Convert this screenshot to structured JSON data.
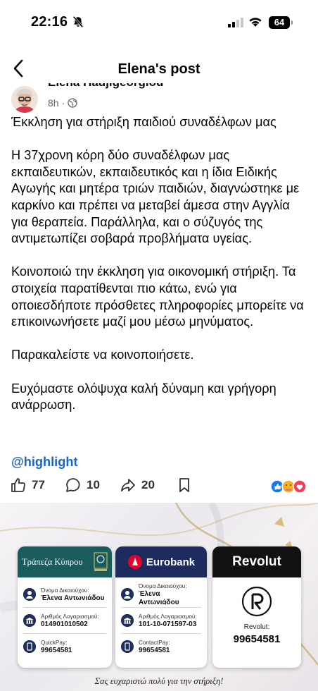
{
  "status_bar": {
    "time": "22:16",
    "battery": "64"
  },
  "nav": {
    "title": "Elena's post"
  },
  "author": {
    "name": "Elena Hadjigeorgiou",
    "time_ago": "8h",
    "separator": "·"
  },
  "post": {
    "text": "Έκκληση για στήριξη παιδιού συναδέλφων μας\n\nΗ 37χρονη κόρη δύο συναδέλφων μας εκπαιδευτικών, εκπαιδευτικός και η ίδια Ειδικής Αγωγής και μητέρα τριών παιδιών, διαγνώστηκε με καρκίνο και πρέπει να μεταβεί άμεσα στην Αγγλία για θεραπεία. Παράλληλα, και ο σύζυγός της αντιμετωπίζει σοβαρά προβλήματα υγείας.\n\nΚοινοποιώ την έκκληση για οικονομική στήριξη. Τα στοιχεία παρατίθενται πιο κάτω, ενώ για οποιεσδήποτε πρόσθετες πληροφορίες μπορείτε να επικοινωνήσετε μαζί μου μέσω μηνύματος.\n\nΠαρακαλείστε να κοινοποιήσετε.\n\nΕυχόμαστε ολόψυχα καλή δύναμη και γρήγορη ανάρρωση.",
    "hashtag": "@highlight"
  },
  "actions": {
    "likes": "77",
    "comments": "10",
    "shares": "20"
  },
  "banner": {
    "cards": [
      {
        "bank": "Τράπεζα Κύπρου",
        "header_color": "#1a5c5c",
        "rows": [
          {
            "label": "Όνομα Δικαιούχου:",
            "value": "Έλενα Αντωνιάδου"
          },
          {
            "label": "Αριθμός Λογαριασμού:",
            "value": "014901010502"
          },
          {
            "label": "QuickPay:",
            "value": "99654581"
          }
        ]
      },
      {
        "bank": "Eurobank",
        "header_color": "#1d2b5e",
        "rows": [
          {
            "label": "Όνομα Δικαιούχου:",
            "value": "Έλενα Αντωνιάδου"
          },
          {
            "label": "Αριθμός Λογαριασμού:",
            "value": "101-10-071597-03"
          },
          {
            "label": "ContactPay:",
            "value": "99654581"
          }
        ]
      },
      {
        "bank": "Revolut",
        "header_color": "#111111",
        "label": "Revolut:",
        "value": "99654581"
      }
    ],
    "caption": "Σας ευχαριστώ πολύ για την στήριξη!"
  }
}
